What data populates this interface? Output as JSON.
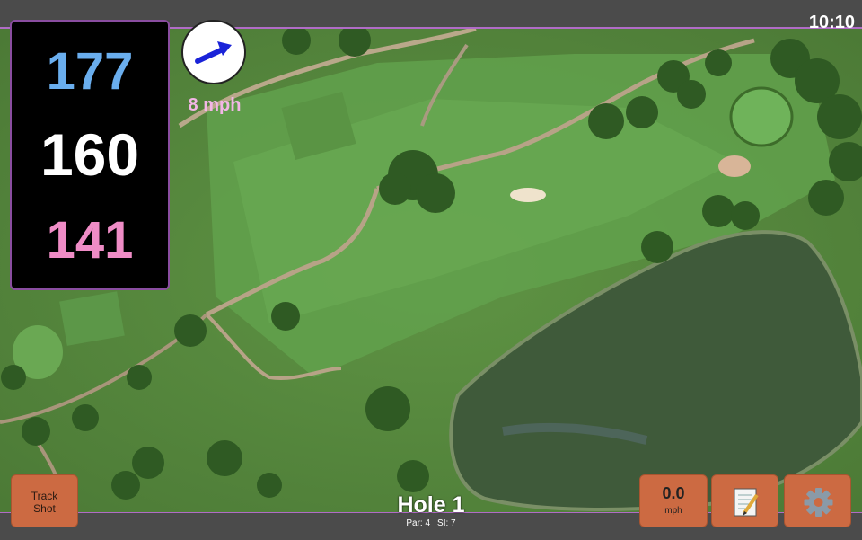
{
  "status": {
    "time": "10:10"
  },
  "distances": {
    "back": "177",
    "middle": "160",
    "front": "141"
  },
  "wind": {
    "speed": "8 mph",
    "icon": "wind-direction-arrow-icon"
  },
  "track_shot": {
    "line1": "Track",
    "line2": "Shot"
  },
  "speed": {
    "value": "0.0",
    "unit": "mph"
  },
  "hole": {
    "title": "Hole 1",
    "par": "Par: 4",
    "si": "SI: 7"
  },
  "icons": {
    "notes": "notepad-icon",
    "settings": "gear-icon"
  },
  "colors": {
    "back": "#6aaeee",
    "middle": "#ffffff",
    "front": "#ef8cc6",
    "button": "#cc6a42",
    "accent": "#b06cc6"
  }
}
